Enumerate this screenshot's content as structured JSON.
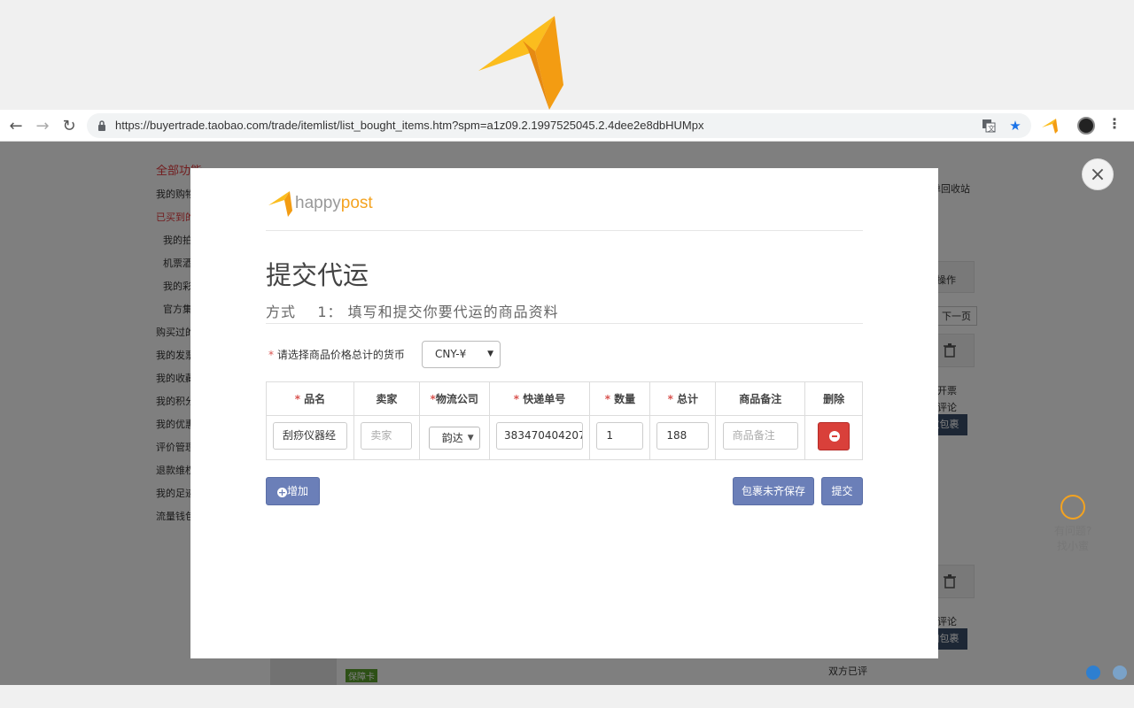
{
  "browser": {
    "url": "https://buyertrade.taobao.com/trade/itemlist/list_bought_items.htm?spm=a1z09.2.1997525045.2.4dee2e8dbHUMpx",
    "back_icon": "←",
    "forward_icon": "→",
    "reload_icon": "↻",
    "translate_icon": "translate-icon",
    "star_icon": "★",
    "menu_icon": "⋮"
  },
  "background_page": {
    "sidebar": [
      {
        "label": "全部功能"
      },
      {
        "label": "我的购物车"
      },
      {
        "label": "已买到的宝贝"
      },
      {
        "label": "我的拍卖"
      },
      {
        "label": "机票酒店"
      },
      {
        "label": "我的彩票"
      },
      {
        "label": "官方集运"
      },
      {
        "label": "购买过的店铺"
      },
      {
        "label": "我的发票"
      },
      {
        "label": "我的收藏"
      },
      {
        "label": "我的积分"
      },
      {
        "label": "我的优惠"
      },
      {
        "label": "评价管理"
      },
      {
        "label": "退款维权"
      },
      {
        "label": "我的足迹"
      },
      {
        "label": "流量钱包"
      }
    ],
    "right": {
      "recycle": "订单回收站",
      "ops": "操作",
      "next_page": "下一页",
      "invoice": "开票",
      "review1": "评论",
      "pack1": "改包裹",
      "review2": "评论",
      "pack2": "加包裹",
      "both_reviewed": "双方已评",
      "insurance": "保障卡"
    },
    "help": {
      "line1": "有问题?",
      "line2": "找小蜜"
    }
  },
  "modal": {
    "close_icon": "×",
    "brand_happy": "happy",
    "brand_post": "post",
    "title": "提交代运",
    "subtitle_prefix": "方式",
    "subtitle_num": "1",
    "subtitle_text": "：  填写和提交你要代运的商品资料",
    "currency_label": "请选择商品价格总计的货币",
    "currency_value": "CNY-¥",
    "required_mark": "*",
    "table": {
      "headers": [
        {
          "label": "品名",
          "required": true
        },
        {
          "label": "卖家",
          "required": false
        },
        {
          "label": "物流公司",
          "required": true
        },
        {
          "label": "快递单号",
          "required": true
        },
        {
          "label": "数量",
          "required": true
        },
        {
          "label": "总计",
          "required": true
        },
        {
          "label": "商品备注",
          "required": false
        },
        {
          "label": "删除",
          "required": false
        }
      ],
      "row": {
        "name": "刮痧仪器经",
        "seller_placeholder": "卖家",
        "courier": "韵达",
        "tracking": "383470404207",
        "qty": "1",
        "total": "188",
        "note_placeholder": "商品备注"
      }
    },
    "add_button": "增加",
    "save_button": "包裹未齐保存",
    "submit_button": "提交"
  }
}
